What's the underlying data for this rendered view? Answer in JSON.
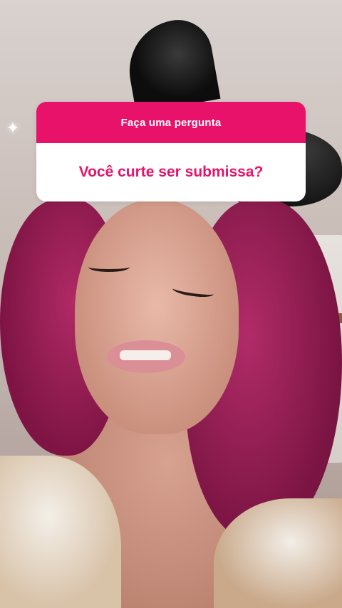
{
  "sticker": {
    "header": "Faça uma pergunta",
    "question": "Você curte ser submissa?",
    "accent_color": "#e8126a"
  },
  "background": {
    "description_icon": "sparkle-icon"
  }
}
